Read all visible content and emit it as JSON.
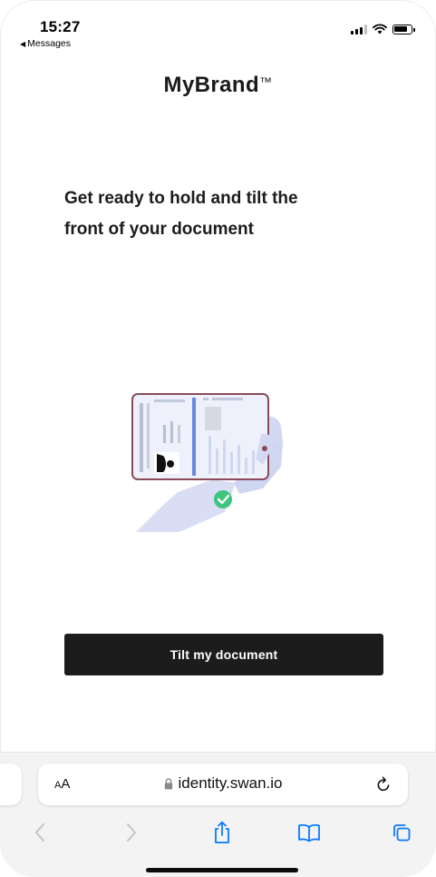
{
  "status_bar": {
    "time": "15:27",
    "back_label": "Messages"
  },
  "brand": {
    "name": "MyBrand",
    "mark": "™"
  },
  "content": {
    "heading_line1": "Get ready to hold and tilt the",
    "heading_line2": "front of your document",
    "illustration_icon": "hand-holding-id-document-icon",
    "button_label": "Tilt my document"
  },
  "browser": {
    "text_size_label_small": "A",
    "text_size_label_large": "A",
    "url": "identity.swan.io",
    "icons": {
      "lock": "lock-icon",
      "reload": "reload-icon",
      "back": "back-chevron-icon",
      "forward": "forward-chevron-icon",
      "share": "share-icon",
      "bookmarks": "bookmarks-icon",
      "tabs": "tabs-icon"
    }
  },
  "colors": {
    "button_bg": "#1c1c1c",
    "accent_blue": "#0a7aff",
    "check_green": "#3dc47e",
    "doc_frame": "#8c4a5a"
  }
}
